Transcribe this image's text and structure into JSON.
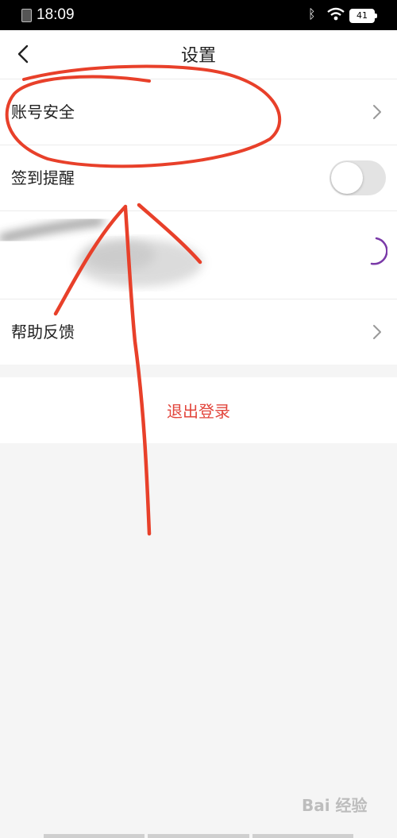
{
  "status_bar": {
    "time": "18:09",
    "battery": "41"
  },
  "header": {
    "title": "设置",
    "back_icon": "chevron-left-icon"
  },
  "settings": {
    "account_security": {
      "label": "账号安全",
      "icon": "chevron-right-icon"
    },
    "checkin_reminder": {
      "label": "签到提醒",
      "toggle_on": false
    },
    "help_feedback": {
      "label": "帮助反馈",
      "icon": "chevron-right-icon"
    }
  },
  "logout": {
    "label": "退出登录",
    "color": "#e2453c"
  },
  "watermark": {
    "text": "Bai 经验"
  },
  "colors": {
    "annotation": "#e8402a",
    "accent": "#e2453c"
  }
}
